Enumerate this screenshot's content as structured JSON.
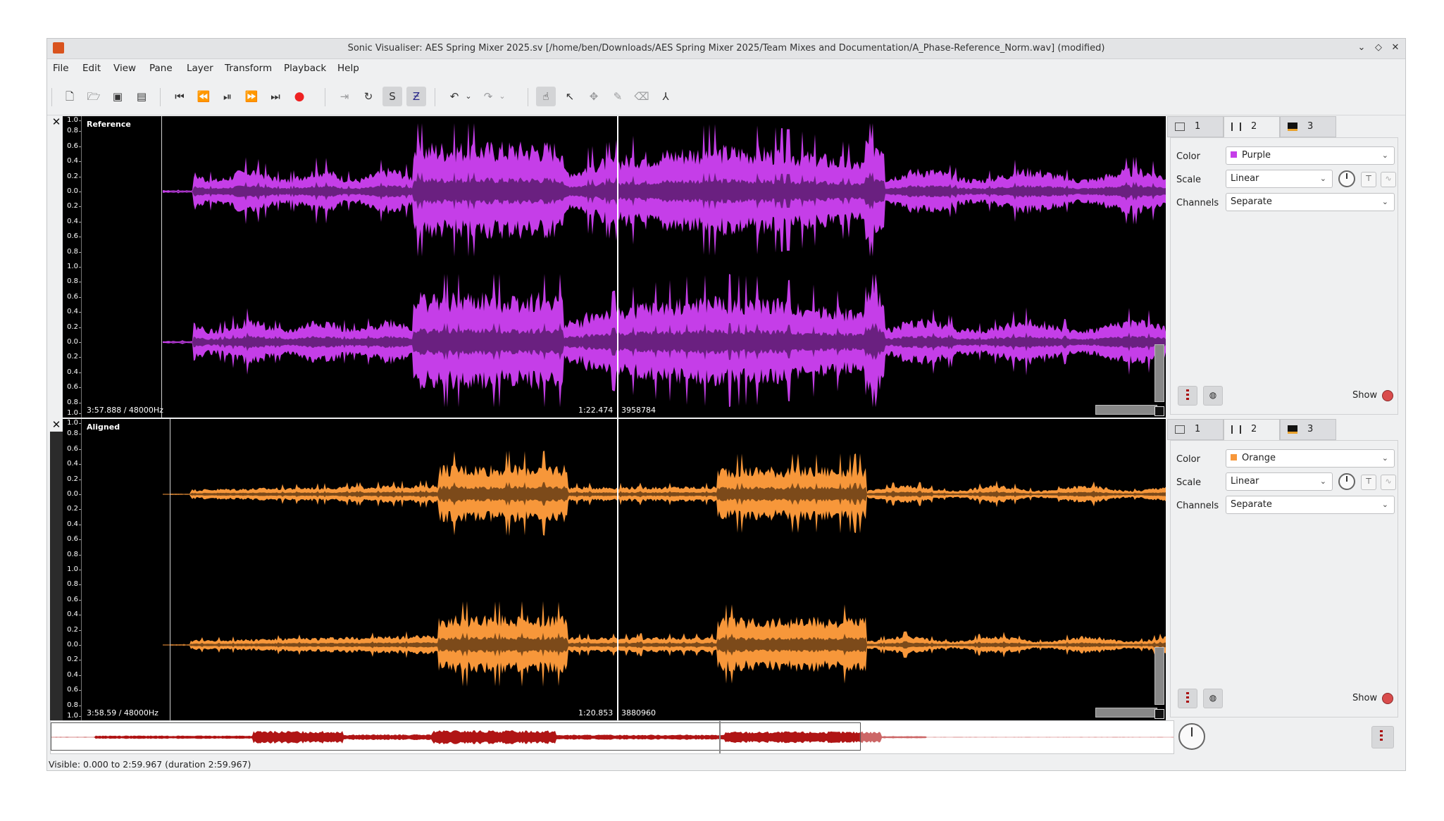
{
  "window": {
    "title": "Sonic Visualiser: AES Spring Mixer 2025.sv [/home/ben/Downloads/AES Spring Mixer 2025/Team Mixes and Documentation/A_Phase-Reference_Norm.wav] (modified)"
  },
  "menu": [
    "File",
    "Edit",
    "View",
    "Pane",
    "Layer",
    "Transform",
    "Playback",
    "Help"
  ],
  "toolbar": {
    "icons": [
      "new-document-icon",
      "open-folder-icon",
      "save-icon",
      "save-as-icon",
      "rewind-start-icon",
      "rewind-icon",
      "play-pause-icon",
      "fast-forward-icon",
      "forward-end-icon",
      "record-icon",
      "play-selection-icon",
      "loop-icon",
      "solo-icon",
      "follow-playback-icon",
      "undo-icon",
      "undo-menu-icon",
      "redo-icon",
      "redo-menu-icon",
      "navigate-tool-icon",
      "select-tool-icon",
      "move-tool-icon",
      "draw-tool-icon",
      "erase-tool-icon",
      "measure-tool-icon"
    ]
  },
  "scale_ticks": [
    "1.0",
    "0.8",
    "0.6",
    "0.4",
    "0.2",
    "0.0",
    "0.2",
    "0.4",
    "0.6",
    "0.8",
    "1.0",
    "0.8",
    "0.6",
    "0.4",
    "0.2",
    "0.0",
    "0.2",
    "0.4",
    "0.6",
    "0.8",
    "1.0"
  ],
  "panes": [
    {
      "label": "Reference",
      "info": "3:57.888 / 48000Hz",
      "cursor_time": "1:22.474",
      "cursor_frame": "3958784",
      "color": "#c53ee8",
      "color_dark": "#6a2080",
      "props": {
        "tabs": [
          "1",
          "2",
          "3"
        ],
        "color_label": "Color",
        "color_value": "Purple",
        "swatch": "#c53ee8",
        "scale_label": "Scale",
        "scale_value": "Linear",
        "channels_label": "Channels",
        "channels_value": "Separate",
        "show_label": "Show"
      }
    },
    {
      "label": "Aligned",
      "info": "3:58.59 / 48000Hz",
      "cursor_time": "1:20.853",
      "cursor_frame": "3880960",
      "color": "#f7973a",
      "color_dark": "#7c4a1a",
      "props": {
        "tabs": [
          "1",
          "2",
          "3"
        ],
        "color_label": "Color",
        "color_value": "Orange",
        "swatch": "#f7973a",
        "scale_label": "Scale",
        "scale_value": "Linear",
        "channels_label": "Channels",
        "channels_value": "Separate",
        "show_label": "Show"
      }
    }
  ],
  "overview": {
    "wave_color": "#b01515",
    "wave_color_light": "#cc6666"
  },
  "status": "Visible: 0.000 to 2:59.967 (duration 2:59.967)"
}
